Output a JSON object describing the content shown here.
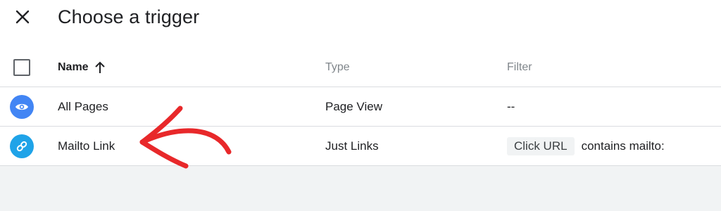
{
  "header": {
    "title": "Choose a trigger",
    "close_icon": "close-icon"
  },
  "table": {
    "columns": [
      "Name",
      "Type",
      "Filter"
    ],
    "sort_icon": "arrow-up-icon",
    "rows": [
      {
        "icon": "eye-icon",
        "icon_color": "#4285f4",
        "name": "All Pages",
        "type": "Page View",
        "filter": "--"
      },
      {
        "icon": "link-icon",
        "icon_color": "#1fa3e8",
        "name": "Mailto Link",
        "type": "Just Links",
        "filter_chip": "Click URL",
        "filter": "contains mailto:"
      }
    ]
  },
  "annotation": {
    "color": "#e8282a",
    "icon": "red-arrow-annotation"
  }
}
